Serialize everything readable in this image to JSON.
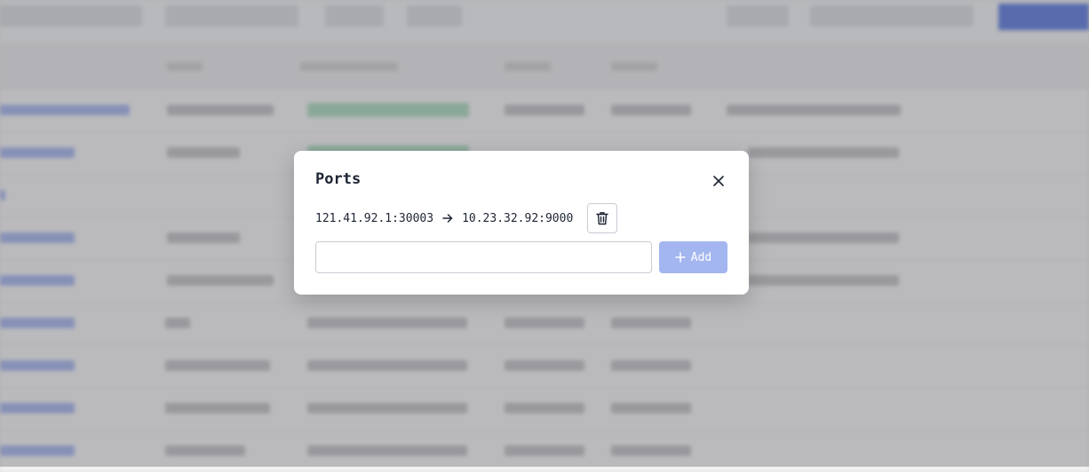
{
  "modal": {
    "title": "Ports",
    "mapping": {
      "source": "121.41.92.1:30003",
      "target": "10.23.32.92:9000"
    },
    "input_value": "",
    "input_placeholder": "",
    "add_label": "Add",
    "icons": {
      "close": "close-icon",
      "arrow": "arrow-right-icon",
      "delete": "trash-icon",
      "add": "plus-icon"
    }
  },
  "colors": {
    "overlay": "#6e6e72",
    "add_button": "#a4b6f0",
    "accent": "#4a6ad8"
  }
}
